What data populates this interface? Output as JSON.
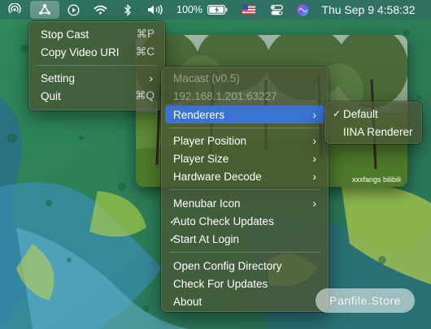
{
  "menubar": {
    "icons": [
      "airdrop-icon",
      "macast-icon",
      "play-icon",
      "wifi-icon",
      "bluetooth-icon",
      "volume-icon",
      "battery-icon",
      "flag-icon",
      "control-center-icon",
      "siri-icon"
    ],
    "battery": "100%",
    "clock": "Thu Sep 9  4:58:32"
  },
  "main_menu": {
    "items": [
      {
        "label": "Stop Cast",
        "shortcut": "⌘P"
      },
      {
        "label": "Copy Video URI",
        "shortcut": "⌘C"
      },
      {
        "label": "Setting",
        "submenu": true
      },
      {
        "label": "Quit",
        "shortcut": "⌘Q"
      }
    ]
  },
  "setting_menu": {
    "app_version": "Macast (v0.5)",
    "address": "192.168.1.201:63227",
    "items": [
      {
        "label": "Renderers",
        "submenu": true
      },
      {
        "label": "Player Position",
        "submenu": true
      },
      {
        "label": "Player Size",
        "submenu": true
      },
      {
        "label": "Hardware Decode",
        "submenu": true
      },
      {
        "label": "Menubar Icon",
        "submenu": true
      },
      {
        "label": "Auto Check Updates",
        "checked": true
      },
      {
        "label": "Start At Login",
        "checked": true
      },
      {
        "label": "Open Config Directory"
      },
      {
        "label": "Check For Updates"
      },
      {
        "label": "About"
      }
    ]
  },
  "renderers_menu": {
    "items": [
      {
        "label": "Default",
        "checked": true
      },
      {
        "label": "IINA Renderer"
      }
    ]
  },
  "video_overlay": {
    "watermark": "xxxfangs bilibili"
  },
  "watermark": "Panfile.Store",
  "glyphs": {
    "chevron": "›",
    "check": "✓"
  },
  "colors": {
    "highlight": "#3a72d8"
  }
}
